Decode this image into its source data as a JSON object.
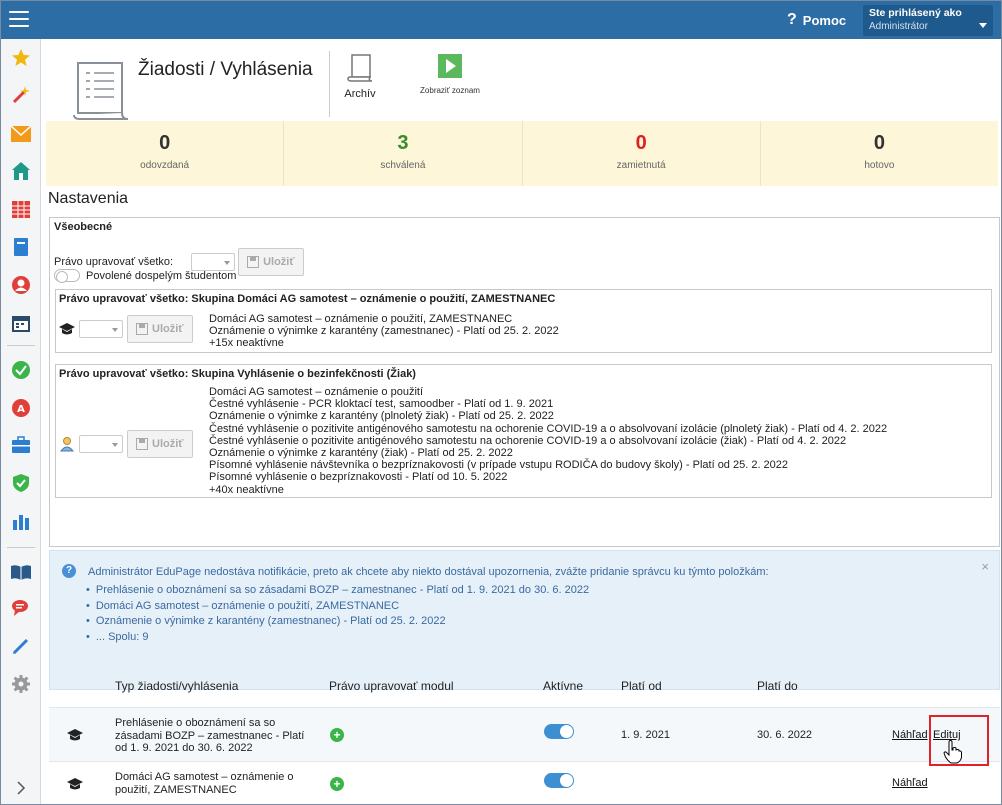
{
  "topbar": {
    "help_label": "Pomoc",
    "user_line1": "Ste prihlásený ako",
    "user_line2": "Administrátor"
  },
  "sidebar": {
    "icons": [
      "star-icon",
      "magic-wand-icon",
      "mail-icon",
      "home-icon",
      "timetable-icon",
      "book-icon",
      "person-icon",
      "calendar-icon",
      "check-circle-icon",
      "grade-icon",
      "briefcase-icon",
      "shield-check-icon",
      "bar-chart-icon",
      "open-book-icon",
      "chat-icon",
      "pen-icon",
      "gear-icon",
      "expand-icon"
    ]
  },
  "header": {
    "title": "Žiadosti / Vyhlásenia",
    "archiv_label": "Archív",
    "zobrazit_label": "Zobraziť zoznam"
  },
  "stats": [
    {
      "value": "0",
      "label": "odovzdaná",
      "color": "#333333"
    },
    {
      "value": "3",
      "label": "schválená",
      "color": "#3a8a2e"
    },
    {
      "value": "0",
      "label": "zamietnutá",
      "color": "#e02020"
    },
    {
      "value": "0",
      "label": "hotovo",
      "color": "#333333"
    }
  ],
  "settings": {
    "heading": "Nastavenia",
    "general_label": "Všeobecné",
    "edit_all_label": "Právo upravovať všetko:",
    "save_label": "Uložiť",
    "adult_students_label": "Povolené dospelým študentom",
    "group1": {
      "title": "Právo upravovať všetko: Skupina Domáci AG samotest – oznámenie o použití, ZAMESTNANEC",
      "items": [
        "Domáci AG samotest – oznámenie o použití, ZAMESTNANEC",
        "Oznámenie o výnimke z karantény (zamestnanec) - Platí od 25. 2. 2022",
        "+15x neaktívne"
      ]
    },
    "group2": {
      "title": "Právo upravovať všetko: Skupina Vyhlásenie o bezinfekčnosti (Žiak)",
      "items": [
        "Domáci AG samotest – oznámenie o použití",
        "Čestné vyhlásenie - PCR kloktací test, samoodber - Platí od 1. 9. 2021",
        "Oznámenie o výnimke z karantény (plnoletý žiak) - Platí od 25. 2. 2022",
        "Čestné vyhlásenie o pozitivite antigénového samotestu na ochorenie COVID-19 a o absolvovaní izolácie (plnoletý žiak) - Platí od 4. 2. 2022",
        "Čestné vyhlásenie o pozitivite antigénového samotestu na ochorenie COVID-19 a o absolvovaní izolácie (žiak) - Platí od 4. 2. 2022",
        "Oznámenie o výnimke z karantény (žiak) - Platí od 25. 2. 2022",
        "Písomné vyhlásenie návštevníka o bezpríznakovosti (v prípade vstupu RODIČA do budovy školy) - Platí od 25. 2. 2022",
        "Písomné vyhlásenie o bezpríznakovosti - Platí od 10. 5. 2022",
        "+40x neaktívne"
      ]
    }
  },
  "notice": {
    "text": "Administrátor EduPage nedostáva notifikácie, preto ak chcete aby niekto dostával upozornenia, zvážte pridanie správcu ku týmto položkám:",
    "items": [
      "Prehlásenie o oboznámení sa so zásadami BOZP – zamestnanec - Platí od 1. 9. 2021 do 30. 6. 2022",
      "Domáci AG samotest – oznámenie o použití, ZAMESTNANEC",
      "Oznámenie o výnimke z karantény (zamestnanec) - Platí od 25. 2. 2022",
      "... Spolu: 9"
    ],
    "close": "×"
  },
  "table": {
    "headers": [
      "Typ žiadosti/vyhlásenia",
      "Právo upravovať modul",
      "Aktívne",
      "Platí od",
      "Platí do"
    ],
    "rows": [
      {
        "name_lines": [
          "Prehlásenie o oboznámení sa so",
          "zásadami BOZP – zamestnanec - Platí",
          "od 1. 9. 2021 do 30. 6. 2022"
        ],
        "active": true,
        "from": "1. 9. 2021",
        "to": "30. 6. 2022",
        "preview": "Náhľad",
        "edit": "Edituj"
      },
      {
        "name_lines": [
          "Domáci AG samotest – oznámenie o",
          "použití, ZAMESTNANEC"
        ],
        "active": true,
        "from": "",
        "to": "",
        "preview": "Náhľad",
        "edit": ""
      }
    ]
  }
}
